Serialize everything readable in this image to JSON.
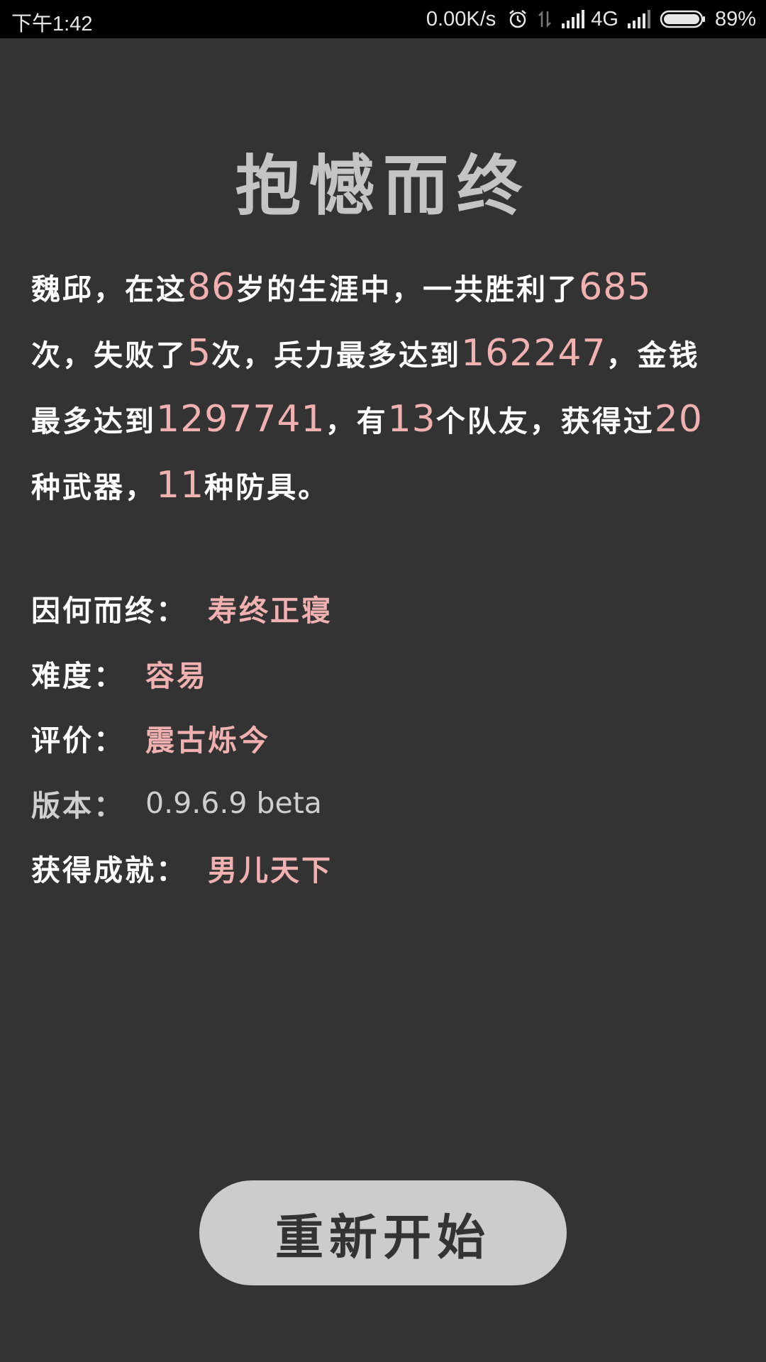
{
  "status_bar": {
    "time": "下午1:42",
    "net_speed": "0.00K/s",
    "network_type": "4G",
    "battery_percent": "89%",
    "battery_level": 0.89,
    "icons": [
      "alarm-icon",
      "data-transfer-icon",
      "signal-icon",
      "signal-icon",
      "battery-icon"
    ]
  },
  "title": "抱憾而终",
  "summary": {
    "name": "魏邱",
    "t1": "，在这",
    "age": "86",
    "t2": "岁的生涯中，一共胜利了",
    "wins": "685",
    "t3": "次，失败了",
    "losses": "5",
    "t4": "次，兵力最多达到",
    "max_troops": "162247",
    "t5": "，金钱最多达到",
    "max_money": "1297741",
    "t6": "，有",
    "teammates": "13",
    "t7": "个队友，获得过",
    "weapons": "20",
    "t8": "种武器，",
    "armors": "11",
    "t9": "种防具。"
  },
  "info": {
    "cause": {
      "label": "因何而终",
      "colon": "：",
      "value": "寿终正寝"
    },
    "difficulty": {
      "label": "难度",
      "colon": "：",
      "value": "容易"
    },
    "rating": {
      "label": "评价",
      "colon": "：",
      "value": "震古烁今"
    },
    "version": {
      "label": "版本",
      "colon": "：",
      "value": "0.9.6.9 beta"
    },
    "achievement": {
      "label": "获得成就",
      "colon": "：",
      "value": "男儿天下"
    }
  },
  "restart_button": {
    "label": "重新开始"
  },
  "colors": {
    "background": "#333333",
    "status_bar": "#000000",
    "highlight": "#f2b1b1",
    "title": "#c4c4c4",
    "button": "#cccccc"
  }
}
